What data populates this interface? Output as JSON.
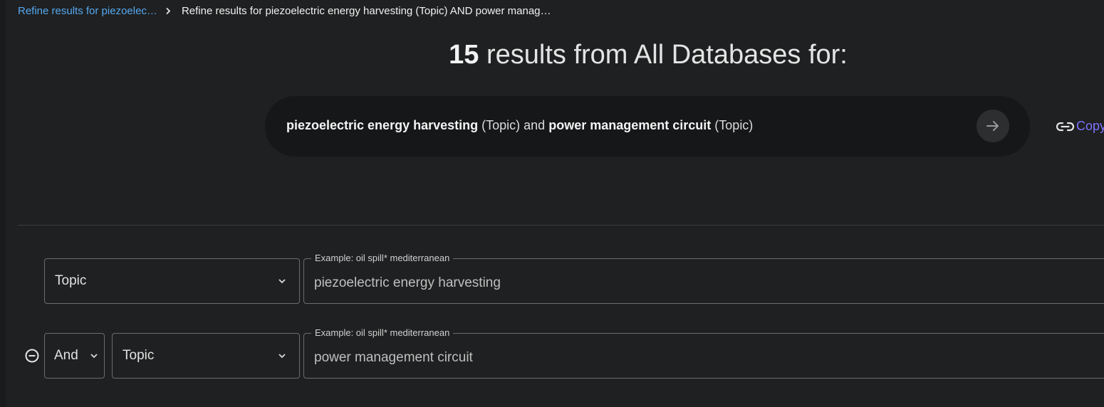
{
  "breadcrumb": {
    "link_label": "Refine results for piezoelec…",
    "current_label": "Refine results for piezoelectric energy harvesting (Topic) AND power manag…"
  },
  "headline": {
    "count": "15",
    "text": "results from All Databases for:"
  },
  "query": {
    "term1": "piezoelectric energy harvesting",
    "field1": "(Topic)",
    "joiner": "and",
    "term2": "power management circuit",
    "field2": "(Topic)"
  },
  "copy_link": {
    "label": "Copy"
  },
  "rows": [
    {
      "field": "Topic",
      "placeholder": "Example: oil spill* mediterranean",
      "value": "piezoelectric energy harvesting"
    },
    {
      "operator": "And",
      "field": "Topic",
      "placeholder": "Example: oil spill* mediterranean",
      "value": "power management circuit"
    }
  ],
  "icons": {
    "breadcrumb_separator": "chevron-right-icon",
    "search_go": "arrow-right-icon",
    "copy": "link-icon",
    "select_caret": "chevron-down-icon",
    "remove_row": "minus-circle-icon"
  },
  "colors": {
    "background": "#1f2021",
    "link": "#55a8ef",
    "accent": "#7d73ff",
    "pill": "#161718"
  }
}
